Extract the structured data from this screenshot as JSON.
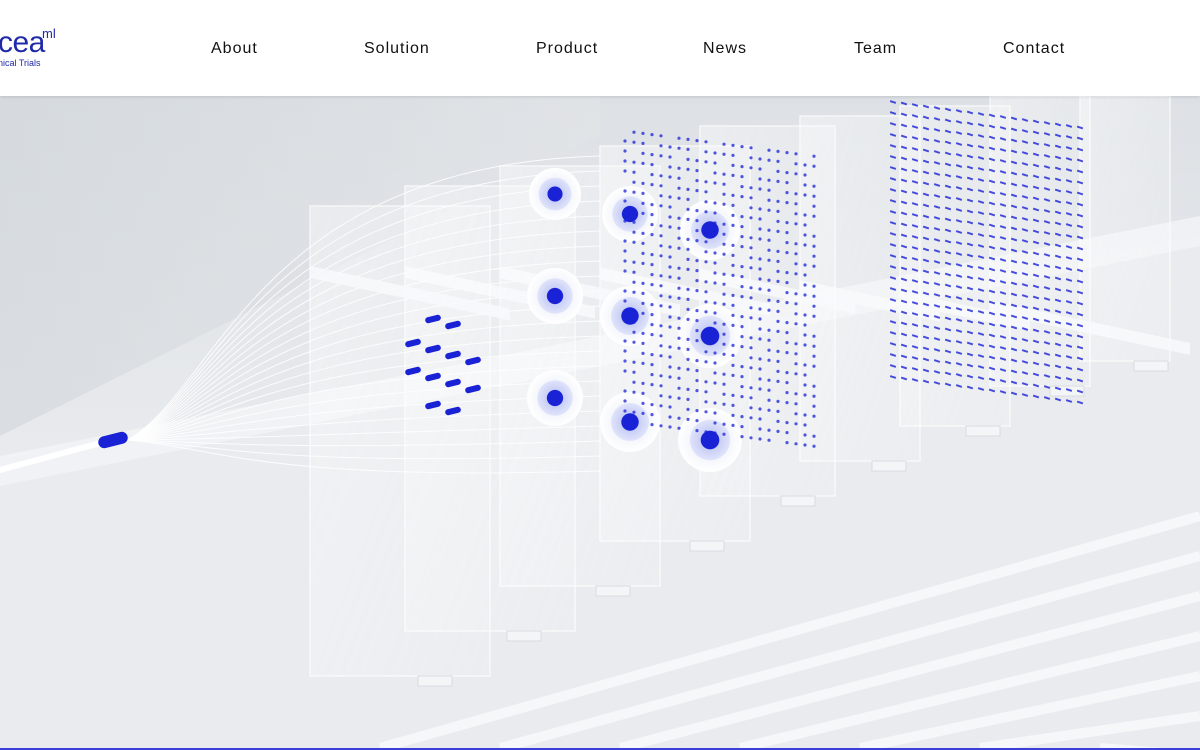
{
  "brand": {
    "word": "cea",
    "superscript": "ml",
    "tagline": "nical Trials",
    "color": "#1f2aa8"
  },
  "nav": {
    "items": [
      {
        "label": "About"
      },
      {
        "label": "Solution"
      },
      {
        "label": "Product"
      },
      {
        "label": "News"
      },
      {
        "label": "Team"
      },
      {
        "label": "Contact"
      }
    ]
  },
  "hero": {
    "accent_color": "#1a22d6",
    "background_color": "#e6e9ec"
  }
}
